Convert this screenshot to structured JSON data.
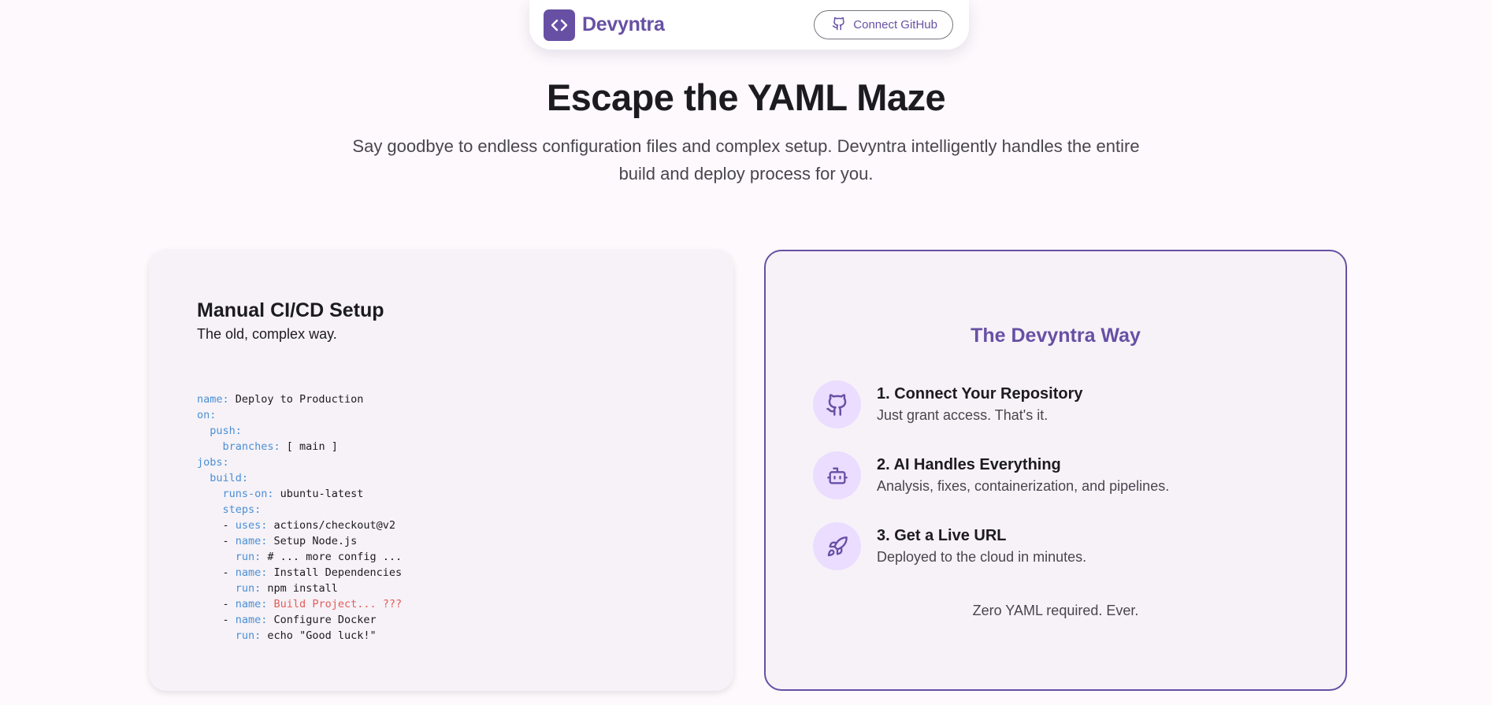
{
  "nav": {
    "brand_name": "Devyntra",
    "connect_label": "Connect GitHub"
  },
  "hero": {
    "title": "Escape the YAML Maze",
    "subtitle": "Say goodbye to endless configuration files and complex setup. Devyntra intelligently handles the entire build and deploy process for you."
  },
  "manual_card": {
    "title": "Manual CI/CD Setup",
    "subtitle": "The old, complex way.",
    "code_lines": [
      {
        "indent": "",
        "key": "name:",
        "value": " Deploy to Production"
      },
      {
        "indent": "",
        "key": "on:",
        "value": ""
      },
      {
        "indent": "  ",
        "key": "push:",
        "value": ""
      },
      {
        "indent": "    ",
        "key": "branches:",
        "value": " [ main ]"
      },
      {
        "indent": "",
        "key": "jobs:",
        "value": ""
      },
      {
        "indent": "  ",
        "key": "build:",
        "value": ""
      },
      {
        "indent": "    ",
        "key": "runs-on:",
        "value": " ubuntu-latest"
      },
      {
        "indent": "    ",
        "key": "steps:",
        "value": ""
      },
      {
        "indent": "    - ",
        "key": "uses:",
        "value": " actions/checkout@v2"
      },
      {
        "indent": "    - ",
        "key": "name:",
        "value": " Setup Node.js"
      },
      {
        "indent": "      ",
        "key": "run:",
        "value": " # ... more config ..."
      },
      {
        "indent": "    - ",
        "key": "name:",
        "value": " Install Dependencies"
      },
      {
        "indent": "      ",
        "key": "run:",
        "value": " npm install"
      },
      {
        "indent": "    - ",
        "key": "name:",
        "value": " Build Project... ???",
        "error": true
      },
      {
        "indent": "    - ",
        "key": "name:",
        "value": " Configure Docker"
      },
      {
        "indent": "      ",
        "key": "run:",
        "value": " echo \"Good luck!\""
      }
    ]
  },
  "devyntra_card": {
    "title": "The Devyntra Way",
    "steps": [
      {
        "icon": "github-icon",
        "title": "1. Connect Your Repository",
        "desc": "Just grant access. That's it."
      },
      {
        "icon": "robot-icon",
        "title": "2. AI Handles Everything",
        "desc": "Analysis, fixes, containerization, and pipelines."
      },
      {
        "icon": "rocket-icon",
        "title": "3. Get a Live URL",
        "desc": "Deployed to the cloud in minutes."
      }
    ],
    "footer": "Zero YAML required. Ever."
  },
  "colors": {
    "primary": "#6750a4",
    "yaml_key": "#4a8fd6",
    "yaml_error": "#e45b58",
    "icon_bg": "#eaddff"
  }
}
